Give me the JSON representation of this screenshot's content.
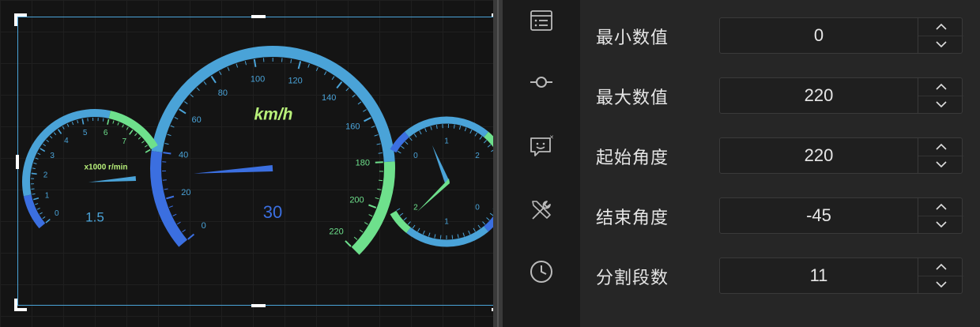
{
  "canvas": {
    "rpm_gauge": {
      "unit_label": "x1000 r/min",
      "value_text": "1.5",
      "value": 1.5,
      "min": 0,
      "max": 8,
      "tick_labels": [
        "0",
        "1",
        "2",
        "3",
        "4",
        "5",
        "6",
        "7"
      ],
      "colors": {
        "low": "#3b6fe0",
        "mid": "#4aa3d8",
        "high": "#6ee08c"
      }
    },
    "speed_gauge": {
      "unit_label": "km/h",
      "value_text": "30",
      "value": 30,
      "min": 0,
      "max": 220,
      "tick_labels": [
        "0",
        "20",
        "40",
        "60",
        "80",
        "100",
        "120",
        "140",
        "160",
        "180",
        "200",
        "220"
      ],
      "colors": {
        "low": "#3b6fe0",
        "mid": "#4aa3d8",
        "high": "#6ee08c",
        "unit": "#b8f07a"
      }
    },
    "clock_gauge": {
      "upper_labels": [
        "0",
        "1",
        "2"
      ],
      "lower_labels": [
        "2",
        "1",
        "0"
      ]
    }
  },
  "sidebar_icons": [
    {
      "name": "list-panel-icon"
    },
    {
      "name": "node-connector-icon"
    },
    {
      "name": "chat-smile-icon"
    },
    {
      "name": "tools-icon"
    },
    {
      "name": "clock-icon"
    }
  ],
  "properties": [
    {
      "label": "最小数值",
      "value": "0"
    },
    {
      "label": "最大数值",
      "value": "220"
    },
    {
      "label": "起始角度",
      "value": "220"
    },
    {
      "label": "结束角度",
      "value": "-45"
    },
    {
      "label": "分割段数",
      "value": "11"
    }
  ]
}
